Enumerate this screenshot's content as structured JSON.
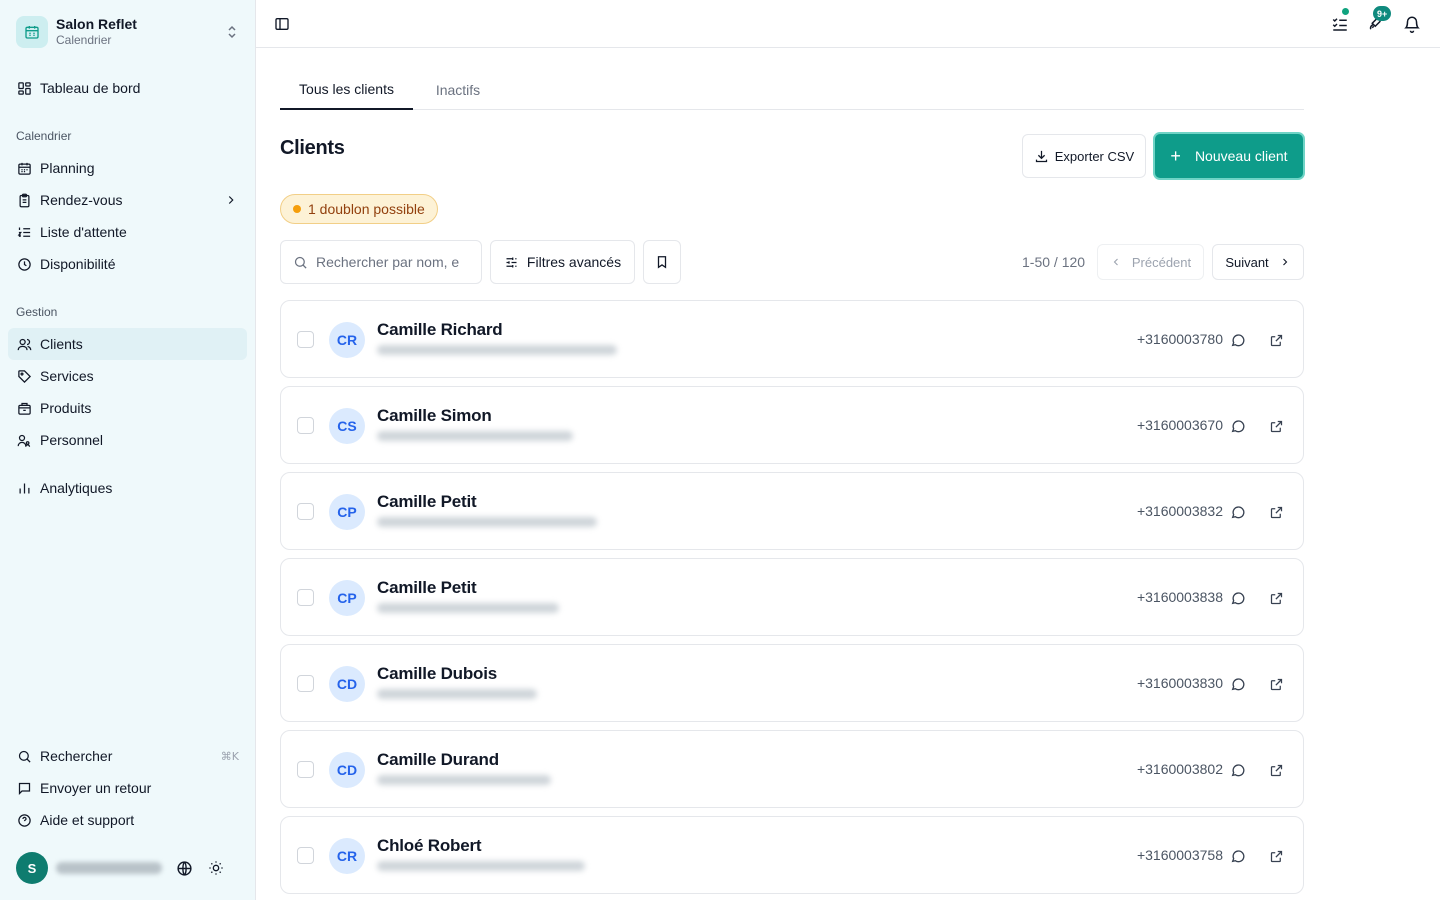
{
  "brand": {
    "name": "Salon Reflet",
    "subtitle": "Calendrier"
  },
  "sidebar": {
    "dashboard": "Tableau de bord",
    "section_calendar": "Calendrier",
    "calendar_items": [
      "Planning",
      "Rendez-vous",
      "Liste d'attente",
      "Disponibilité"
    ],
    "section_management": "Gestion",
    "management_items": [
      "Clients",
      "Services",
      "Produits",
      "Personnel"
    ],
    "analytics": "Analytiques",
    "search": "Rechercher",
    "search_shortcut": "⌘K",
    "feedback": "Envoyer un retour",
    "help": "Aide et support",
    "user_initial": "S"
  },
  "topbar": {
    "notifications_badge": "9+"
  },
  "tabs": [
    "Tous les clients",
    "Inactifs"
  ],
  "page": {
    "title": "Clients",
    "export_label": "Exporter CSV",
    "new_client_label": "Nouveau client",
    "duplicate_badge": "1 doublon possible",
    "search_placeholder": "Rechercher par nom, e",
    "filters_label": "Filtres avancés",
    "pagination_info": "1-50 / 120",
    "prev_label": "Précédent",
    "next_label": "Suivant"
  },
  "clients": [
    {
      "initials": "CR",
      "name": "Camille Richard",
      "phone": "+3160003780"
    },
    {
      "initials": "CS",
      "name": "Camille Simon",
      "phone": "+3160003670"
    },
    {
      "initials": "CP",
      "name": "Camille Petit",
      "phone": "+3160003832"
    },
    {
      "initials": "CP",
      "name": "Camille Petit",
      "phone": "+3160003838"
    },
    {
      "initials": "CD",
      "name": "Camille Dubois",
      "phone": "+3160003830"
    },
    {
      "initials": "CD",
      "name": "Camille Durand",
      "phone": "+3160003802"
    },
    {
      "initials": "CR",
      "name": "Chloé Robert",
      "phone": "+3160003758"
    }
  ],
  "colors": {
    "accent": "#0e9c8a",
    "sidebar_bg": "#eff9fb",
    "avatar_bg": "#dbeafe",
    "avatar_text": "#2563eb",
    "warning": "#f59e0b"
  }
}
